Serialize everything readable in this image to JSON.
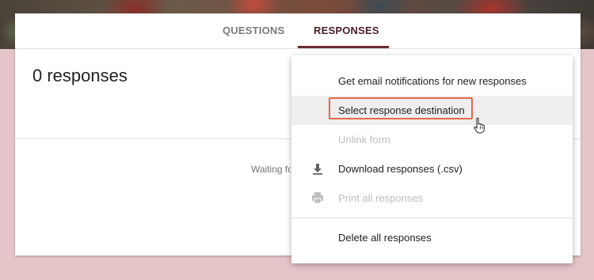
{
  "tabs": {
    "questions": "QUESTIONS",
    "responses": "RESPONSES"
  },
  "responses": {
    "count_label": "0 responses",
    "waiting_text": "Waiting for responses"
  },
  "menu": {
    "items": [
      {
        "label": "Get email notifications for new responses",
        "icon": "",
        "enabled": true
      },
      {
        "label": "Select response destination",
        "icon": "",
        "enabled": true,
        "highlighted": true
      },
      {
        "label": "Unlink form",
        "icon": "",
        "enabled": false
      },
      {
        "label": "Download responses (.csv)",
        "icon": "download-icon",
        "enabled": true
      },
      {
        "label": "Print all responses",
        "icon": "print-icon",
        "enabled": false
      },
      {
        "label": "Delete all responses",
        "icon": "",
        "enabled": true
      }
    ]
  },
  "colors": {
    "page_background": "#e5c5c8",
    "accent": "#6a2a33",
    "highlight_border": "#e4684c"
  }
}
